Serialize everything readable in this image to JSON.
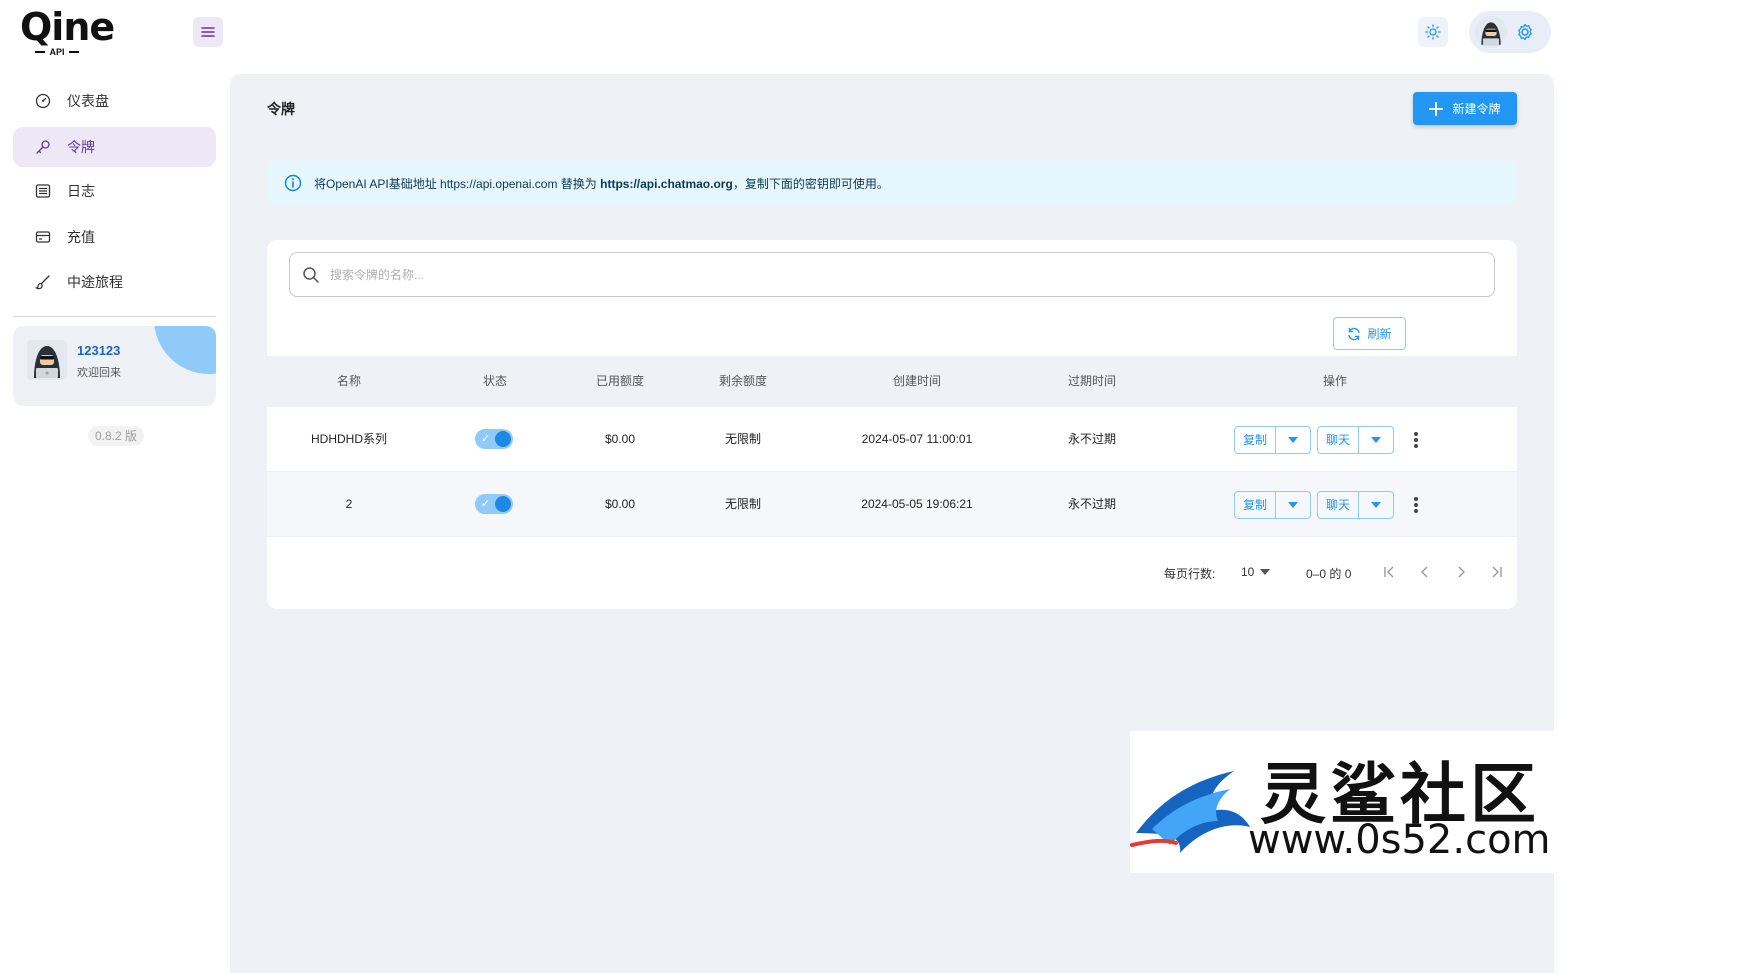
{
  "header": {
    "logo_text": "Qine",
    "logo_sub": "API",
    "menu_icon": "hamburger-icon",
    "theme_icon": "sun-icon",
    "settings_icon": "gear-icon"
  },
  "sidebar": {
    "items": [
      {
        "label": "仪表盘",
        "icon": "dashboard-icon",
        "active": false
      },
      {
        "label": "令牌",
        "icon": "key-icon",
        "active": true
      },
      {
        "label": "日志",
        "icon": "log-icon",
        "active": false
      },
      {
        "label": "充值",
        "icon": "wallet-icon",
        "active": false
      },
      {
        "label": "中途旅程",
        "icon": "brush-icon",
        "active": false
      }
    ],
    "user": {
      "name": "123123",
      "welcome": "欢迎回来"
    },
    "version": "0.8.2 版"
  },
  "main": {
    "title": "令牌",
    "new_button": "新建令牌",
    "alert": {
      "prefix": "将OpenAI API基础地址 https://api.openai.com 替换为 ",
      "bold": "https://api.chatmao.org",
      "suffix": "，复制下面的密钥即可使用。"
    },
    "search": {
      "placeholder": "搜索令牌的名称..."
    },
    "refresh_button": "刷新",
    "table": {
      "headers": [
        "名称",
        "状态",
        "已用额度",
        "剩余额度",
        "创建时间",
        "过期时间",
        "操作"
      ],
      "rows": [
        {
          "name": "HDHDHD系列",
          "enabled": true,
          "used": "$0.00",
          "remaining": "无限制",
          "created": "2024-05-07 11:00:01",
          "expires": "永不过期",
          "copy": "复制",
          "chat": "聊天"
        },
        {
          "name": "2",
          "enabled": true,
          "used": "$0.00",
          "remaining": "无限制",
          "created": "2024-05-05 19:06:21",
          "expires": "永不过期",
          "copy": "复制",
          "chat": "聊天"
        }
      ]
    },
    "pagination": {
      "rows_label": "每页行数:",
      "rows_value": "10",
      "range": "0–0 的 0"
    }
  },
  "watermark": {
    "text": "灵鲨社区",
    "url": "www.0s52.com"
  },
  "colors": {
    "primary": "#2196f3",
    "sidebar_active_bg": "#ede7f6",
    "main_bg": "#eef2f6",
    "alert_bg": "#e5f6fd"
  }
}
